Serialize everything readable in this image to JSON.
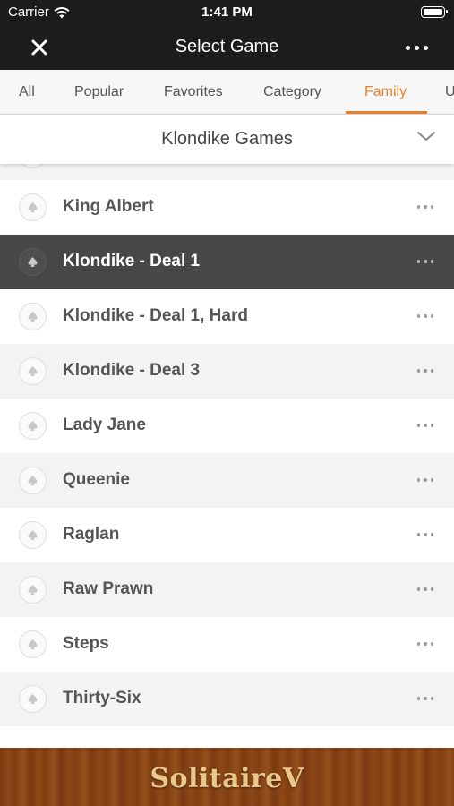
{
  "status_bar": {
    "carrier": "Carrier",
    "time": "1:41 PM"
  },
  "nav": {
    "title": "Select Game",
    "close_icon": "close-icon",
    "more_icon": "more-icon"
  },
  "tabs": [
    {
      "label": "All",
      "active": false
    },
    {
      "label": "Popular",
      "active": false
    },
    {
      "label": "Favorites",
      "active": false
    },
    {
      "label": "Category",
      "active": false
    },
    {
      "label": "Family",
      "active": true
    },
    {
      "label": "U",
      "active": false
    }
  ],
  "family_selector": {
    "title": "Klondike Games",
    "icon": "chevron-down-icon"
  },
  "games": [
    {
      "name": "King Albert",
      "selected": false
    },
    {
      "name": "Klondike - Deal 1",
      "selected": true
    },
    {
      "name": "Klondike - Deal 1, Hard",
      "selected": false
    },
    {
      "name": "Klondike - Deal 3",
      "selected": false
    },
    {
      "name": "Lady Jane",
      "selected": false
    },
    {
      "name": "Queenie",
      "selected": false
    },
    {
      "name": "Raglan",
      "selected": false
    },
    {
      "name": "Raw Prawn",
      "selected": false
    },
    {
      "name": "Steps",
      "selected": false
    },
    {
      "name": "Thirty-Six",
      "selected": false
    }
  ],
  "banner": {
    "logo_text": "SolitaireV"
  },
  "colors": {
    "accent": "#e8812a",
    "header_bg": "#1c1c1c",
    "selected_row": "#474747"
  }
}
